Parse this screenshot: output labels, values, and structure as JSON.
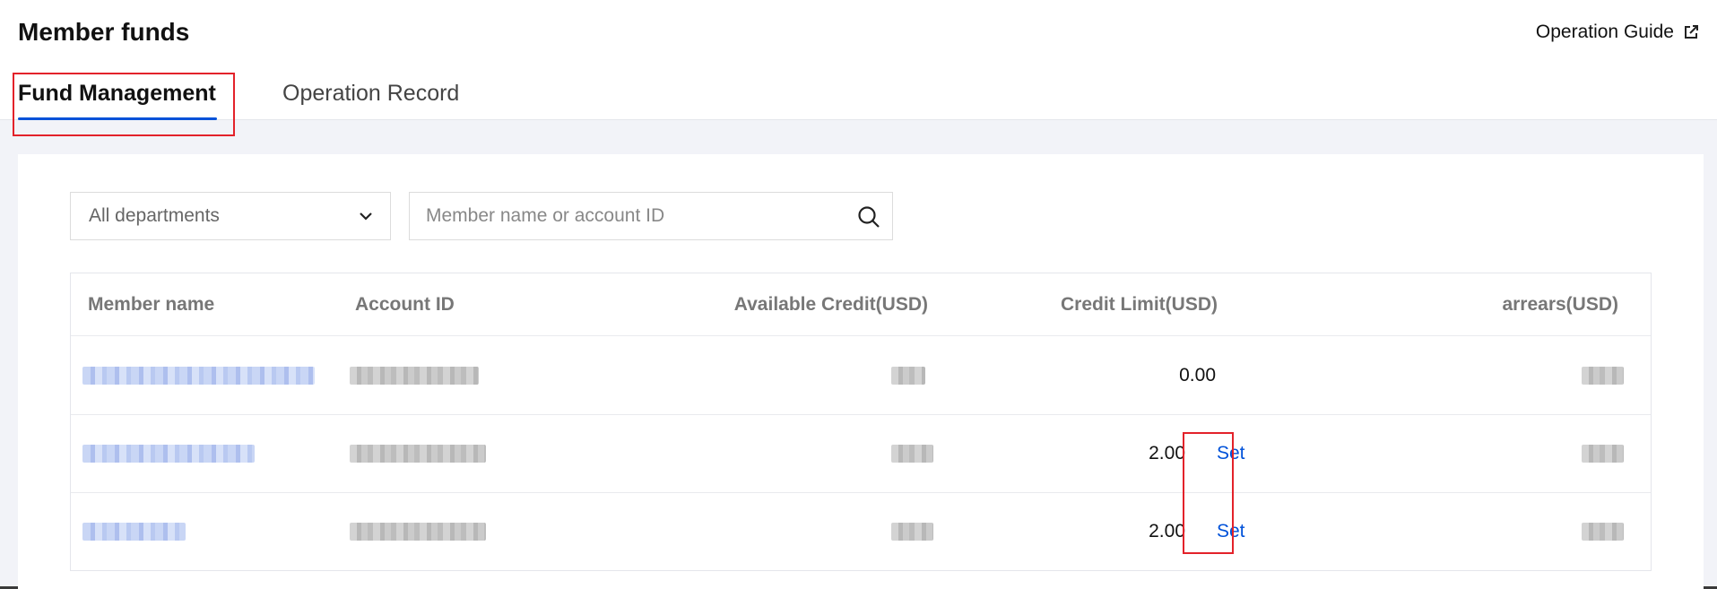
{
  "header": {
    "title": "Member funds",
    "guide_label": "Operation Guide",
    "guide_icon": "external-link-icon"
  },
  "tabs": [
    {
      "label": "Fund Management",
      "active": true
    },
    {
      "label": "Operation Record",
      "active": false
    }
  ],
  "filters": {
    "department": {
      "selected": "All departments"
    },
    "search": {
      "placeholder": "Member name or account ID",
      "value": ""
    }
  },
  "table": {
    "columns": [
      "Member name",
      "Account ID",
      "Available Credit(USD)",
      "Credit Limit(USD)",
      "arrears(USD)"
    ],
    "rows": [
      {
        "member_name": "[redacted]",
        "account_id": "[redacted]",
        "available_credit": "[redacted]",
        "credit_limit": "0.00",
        "action": "",
        "arrears": "[redacted]"
      },
      {
        "member_name": "[redacted]",
        "account_id": "[redacted]",
        "available_credit": "[redacted]",
        "credit_limit": "2.00",
        "action": "Set",
        "arrears": "[redacted]"
      },
      {
        "member_name": "[redacted]",
        "account_id": "[redacted]",
        "available_credit": "[redacted]",
        "credit_limit": "2.00",
        "action": "Set",
        "arrears": "[redacted]"
      }
    ]
  },
  "colors": {
    "accent": "#0052d9",
    "highlight": "#e3222a",
    "background": "#f2f3f8"
  }
}
